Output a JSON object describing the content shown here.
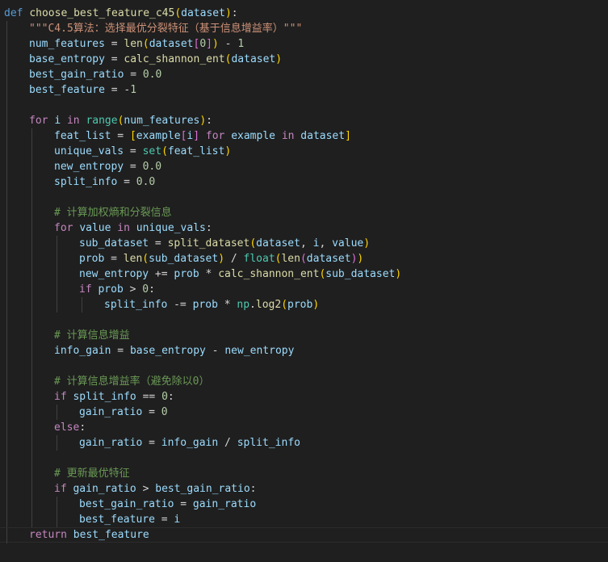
{
  "editor": {
    "language": "python",
    "lines": [
      {
        "indent": 0,
        "tokens": [
          [
            "kw",
            "def"
          ],
          [
            "plain",
            " "
          ],
          [
            "fn",
            "choose_best_feature_c45"
          ],
          [
            "b1",
            "("
          ],
          [
            "var",
            "dataset"
          ],
          [
            "b1",
            ")"
          ],
          [
            "plain",
            ":"
          ]
        ]
      },
      {
        "indent": 1,
        "tokens": [
          [
            "str",
            "\"\"\"C4.5算法：选择最优分裂特征（基于信息增益率）\"\"\""
          ]
        ]
      },
      {
        "indent": 1,
        "tokens": [
          [
            "var",
            "num_features"
          ],
          [
            "op",
            " = "
          ],
          [
            "fn",
            "len"
          ],
          [
            "b1",
            "("
          ],
          [
            "var",
            "dataset"
          ],
          [
            "b2",
            "["
          ],
          [
            "num",
            "0"
          ],
          [
            "b2",
            "]"
          ],
          [
            "b1",
            ")"
          ],
          [
            "op",
            " - "
          ],
          [
            "num",
            "1"
          ]
        ]
      },
      {
        "indent": 1,
        "tokens": [
          [
            "var",
            "base_entropy"
          ],
          [
            "op",
            " = "
          ],
          [
            "fn",
            "calc_shannon_ent"
          ],
          [
            "b1",
            "("
          ],
          [
            "var",
            "dataset"
          ],
          [
            "b1",
            ")"
          ]
        ]
      },
      {
        "indent": 1,
        "tokens": [
          [
            "var",
            "best_gain_ratio"
          ],
          [
            "op",
            " = "
          ],
          [
            "num",
            "0.0"
          ]
        ]
      },
      {
        "indent": 1,
        "tokens": [
          [
            "var",
            "best_feature"
          ],
          [
            "op",
            " = -"
          ],
          [
            "num",
            "1"
          ]
        ]
      },
      {
        "indent": 1,
        "tokens": []
      },
      {
        "indent": 1,
        "tokens": [
          [
            "ctrl",
            "for"
          ],
          [
            "plain",
            " "
          ],
          [
            "var",
            "i"
          ],
          [
            "plain",
            " "
          ],
          [
            "ctrl",
            "in"
          ],
          [
            "plain",
            " "
          ],
          [
            "bi",
            "range"
          ],
          [
            "b1",
            "("
          ],
          [
            "var",
            "num_features"
          ],
          [
            "b1",
            ")"
          ],
          [
            "plain",
            ":"
          ]
        ]
      },
      {
        "indent": 2,
        "tokens": [
          [
            "var",
            "feat_list"
          ],
          [
            "op",
            " = "
          ],
          [
            "b1",
            "["
          ],
          [
            "var",
            "example"
          ],
          [
            "b2",
            "["
          ],
          [
            "var",
            "i"
          ],
          [
            "b2",
            "]"
          ],
          [
            "plain",
            " "
          ],
          [
            "ctrl",
            "for"
          ],
          [
            "plain",
            " "
          ],
          [
            "var",
            "example"
          ],
          [
            "plain",
            " "
          ],
          [
            "ctrl",
            "in"
          ],
          [
            "plain",
            " "
          ],
          [
            "var",
            "dataset"
          ],
          [
            "b1",
            "]"
          ]
        ]
      },
      {
        "indent": 2,
        "tokens": [
          [
            "var",
            "unique_vals"
          ],
          [
            "op",
            " = "
          ],
          [
            "bi",
            "set"
          ],
          [
            "b1",
            "("
          ],
          [
            "var",
            "feat_list"
          ],
          [
            "b1",
            ")"
          ]
        ]
      },
      {
        "indent": 2,
        "tokens": [
          [
            "var",
            "new_entropy"
          ],
          [
            "op",
            " = "
          ],
          [
            "num",
            "0.0"
          ]
        ]
      },
      {
        "indent": 2,
        "tokens": [
          [
            "var",
            "split_info"
          ],
          [
            "op",
            " = "
          ],
          [
            "num",
            "0.0"
          ]
        ]
      },
      {
        "indent": 2,
        "tokens": []
      },
      {
        "indent": 2,
        "tokens": [
          [
            "cmt",
            "# 计算加权熵和分裂信息"
          ]
        ]
      },
      {
        "indent": 2,
        "tokens": [
          [
            "ctrl",
            "for"
          ],
          [
            "plain",
            " "
          ],
          [
            "var",
            "value"
          ],
          [
            "plain",
            " "
          ],
          [
            "ctrl",
            "in"
          ],
          [
            "plain",
            " "
          ],
          [
            "var",
            "unique_vals"
          ],
          [
            "plain",
            ":"
          ]
        ]
      },
      {
        "indent": 3,
        "tokens": [
          [
            "var",
            "sub_dataset"
          ],
          [
            "op",
            " = "
          ],
          [
            "fn",
            "split_dataset"
          ],
          [
            "b1",
            "("
          ],
          [
            "var",
            "dataset"
          ],
          [
            "plain",
            ", "
          ],
          [
            "var",
            "i"
          ],
          [
            "plain",
            ", "
          ],
          [
            "var",
            "value"
          ],
          [
            "b1",
            ")"
          ]
        ]
      },
      {
        "indent": 3,
        "tokens": [
          [
            "var",
            "prob"
          ],
          [
            "op",
            " = "
          ],
          [
            "fn",
            "len"
          ],
          [
            "b1",
            "("
          ],
          [
            "var",
            "sub_dataset"
          ],
          [
            "b1",
            ")"
          ],
          [
            "op",
            " / "
          ],
          [
            "bi",
            "float"
          ],
          [
            "b1",
            "("
          ],
          [
            "fn",
            "len"
          ],
          [
            "b2",
            "("
          ],
          [
            "var",
            "dataset"
          ],
          [
            "b2",
            ")"
          ],
          [
            "b1",
            ")"
          ]
        ]
      },
      {
        "indent": 3,
        "tokens": [
          [
            "var",
            "new_entropy"
          ],
          [
            "op",
            " += "
          ],
          [
            "var",
            "prob"
          ],
          [
            "op",
            " * "
          ],
          [
            "fn",
            "calc_shannon_ent"
          ],
          [
            "b1",
            "("
          ],
          [
            "var",
            "sub_dataset"
          ],
          [
            "b1",
            ")"
          ]
        ]
      },
      {
        "indent": 3,
        "tokens": [
          [
            "ctrl",
            "if"
          ],
          [
            "plain",
            " "
          ],
          [
            "var",
            "prob"
          ],
          [
            "op",
            " > "
          ],
          [
            "num",
            "0"
          ],
          [
            "plain",
            ":"
          ]
        ]
      },
      {
        "indent": 4,
        "tokens": [
          [
            "var",
            "split_info"
          ],
          [
            "op",
            " -= "
          ],
          [
            "var",
            "prob"
          ],
          [
            "op",
            " * "
          ],
          [
            "bi",
            "np"
          ],
          [
            "plain",
            "."
          ],
          [
            "fn",
            "log2"
          ],
          [
            "b1",
            "("
          ],
          [
            "var",
            "prob"
          ],
          [
            "b1",
            ")"
          ]
        ]
      },
      {
        "indent": 2,
        "tokens": []
      },
      {
        "indent": 2,
        "tokens": [
          [
            "cmt",
            "# 计算信息增益"
          ]
        ]
      },
      {
        "indent": 2,
        "tokens": [
          [
            "var",
            "info_gain"
          ],
          [
            "op",
            " = "
          ],
          [
            "var",
            "base_entropy"
          ],
          [
            "op",
            " - "
          ],
          [
            "var",
            "new_entropy"
          ]
        ]
      },
      {
        "indent": 2,
        "tokens": []
      },
      {
        "indent": 2,
        "tokens": [
          [
            "cmt",
            "# 计算信息增益率（避免除以0）"
          ]
        ]
      },
      {
        "indent": 2,
        "tokens": [
          [
            "ctrl",
            "if"
          ],
          [
            "plain",
            " "
          ],
          [
            "var",
            "split_info"
          ],
          [
            "op",
            " == "
          ],
          [
            "num",
            "0"
          ],
          [
            "plain",
            ":"
          ]
        ]
      },
      {
        "indent": 3,
        "tokens": [
          [
            "var",
            "gain_ratio"
          ],
          [
            "op",
            " = "
          ],
          [
            "num",
            "0"
          ]
        ]
      },
      {
        "indent": 2,
        "tokens": [
          [
            "ctrl",
            "else"
          ],
          [
            "plain",
            ":"
          ]
        ]
      },
      {
        "indent": 3,
        "tokens": [
          [
            "var",
            "gain_ratio"
          ],
          [
            "op",
            " = "
          ],
          [
            "var",
            "info_gain"
          ],
          [
            "op",
            " / "
          ],
          [
            "var",
            "split_info"
          ]
        ]
      },
      {
        "indent": 2,
        "tokens": []
      },
      {
        "indent": 2,
        "tokens": [
          [
            "cmt",
            "# 更新最优特征"
          ]
        ]
      },
      {
        "indent": 2,
        "tokens": [
          [
            "ctrl",
            "if"
          ],
          [
            "plain",
            " "
          ],
          [
            "var",
            "gain_ratio"
          ],
          [
            "op",
            " > "
          ],
          [
            "var",
            "best_gain_ratio"
          ],
          [
            "plain",
            ":"
          ]
        ]
      },
      {
        "indent": 3,
        "tokens": [
          [
            "var",
            "best_gain_ratio"
          ],
          [
            "op",
            " = "
          ],
          [
            "var",
            "gain_ratio"
          ]
        ]
      },
      {
        "indent": 3,
        "tokens": [
          [
            "var",
            "best_feature"
          ],
          [
            "op",
            " = "
          ],
          [
            "var",
            "i"
          ]
        ]
      },
      {
        "indent": 1,
        "current": true,
        "tokens": [
          [
            "ctrl",
            "return"
          ],
          [
            "plain",
            " "
          ],
          [
            "var",
            "best_feature"
          ]
        ]
      }
    ]
  }
}
